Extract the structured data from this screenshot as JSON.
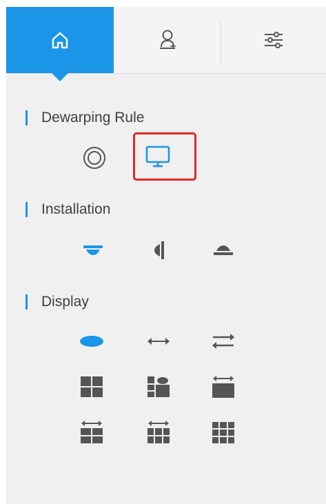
{
  "tabs": [
    {
      "icon": "home-icon",
      "active": true
    },
    {
      "icon": "person-add-icon",
      "active": false
    },
    {
      "icon": "settings-sliders-icon",
      "active": false
    }
  ],
  "sections": {
    "dewarping_rule": {
      "label": "Dewarping Rule"
    },
    "installation": {
      "label": "Installation"
    },
    "display": {
      "label": "Display"
    }
  },
  "dewarping_rule_icons": [
    {
      "icon": "fisheye-circle-icon",
      "selected": false
    },
    {
      "icon": "monitor-icon",
      "selected": true
    }
  ],
  "installation_icons": [
    {
      "icon": "ceiling-mount-icon",
      "selected": true
    },
    {
      "icon": "wall-mount-icon",
      "selected": false
    },
    {
      "icon": "ground-mount-icon",
      "selected": false
    }
  ],
  "display_icons": [
    {
      "icon": "ellipse-view-icon",
      "selected": true
    },
    {
      "icon": "panorama-180-icon",
      "selected": false
    },
    {
      "icon": "panorama-360-double-icon",
      "selected": false
    },
    {
      "icon": "grid-1p3-icon",
      "selected": false
    },
    {
      "icon": "grid-1p3-alt-icon",
      "selected": false
    },
    {
      "icon": "panorama-plus-view-icon",
      "selected": false
    },
    {
      "icon": "panorama-plus-4-icon",
      "selected": false
    },
    {
      "icon": "panorama-plus-8-icon",
      "selected": false
    },
    {
      "icon": "grid-9-icon",
      "selected": false
    }
  ],
  "colors": {
    "accent": "#1b95e8",
    "selection_outline": "#e52525",
    "icon_gray": "#555555",
    "panel_bg": "#f0f0f0"
  }
}
